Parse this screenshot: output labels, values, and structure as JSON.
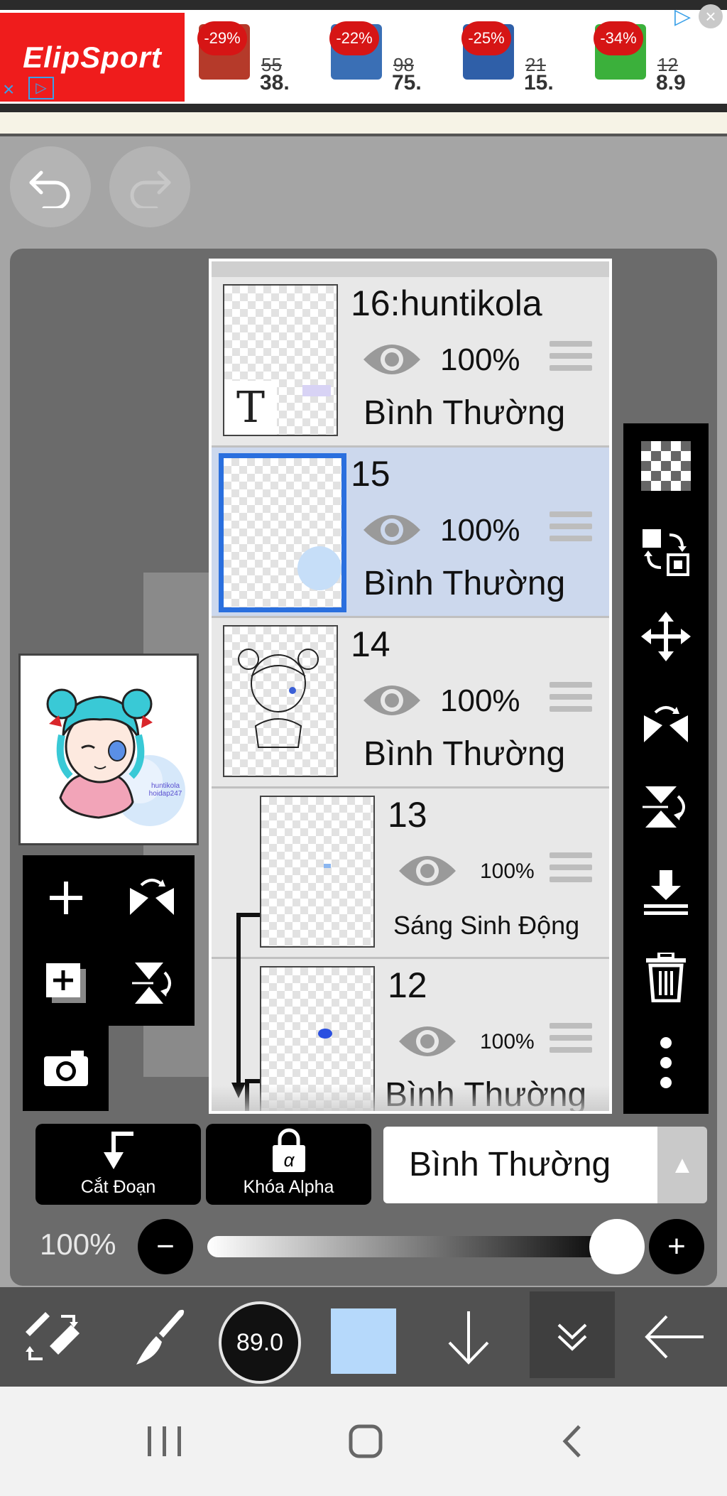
{
  "ad": {
    "brand": "ElipSport",
    "products": [
      {
        "discount": "-29%",
        "old_price": "55",
        "new_price": "38.",
        "color": "#b53a2a"
      },
      {
        "discount": "-22%",
        "old_price": "98",
        "new_price": "75.",
        "color": "#3a6fb5"
      },
      {
        "discount": "-25%",
        "old_price": "21",
        "new_price": "15.",
        "color": "#2f5fa8"
      },
      {
        "discount": "-34%",
        "old_price": "12",
        "new_price": "8.9",
        "color": "#3bb03b"
      }
    ]
  },
  "toolbar_top": {
    "undo_icon": "undo-arrow",
    "redo_icon": "redo-arrow"
  },
  "layers": [
    {
      "name": "16:huntikola",
      "opacity": "100%",
      "blend": "Bình Thường",
      "type": "text",
      "text_marker": "T",
      "selected": false,
      "clipped": false
    },
    {
      "name": "15",
      "opacity": "100%",
      "blend": "Bình Thường",
      "type": "image",
      "selected": true,
      "clipped": false
    },
    {
      "name": "14",
      "opacity": "100%",
      "blend": "Bình Thường",
      "type": "image",
      "selected": false,
      "clipped": false
    },
    {
      "name": "13",
      "opacity": "100%",
      "blend": "Sáng Sinh Động",
      "type": "image",
      "selected": false,
      "clipped": true
    },
    {
      "name": "12",
      "opacity": "100%",
      "blend": "Bình Thường",
      "type": "image",
      "selected": false,
      "clipped": true
    }
  ],
  "preview_text": "huntikola hoidap247",
  "layer_actions": {
    "clip_label": "Cắt Đoạn",
    "alpha_glyph": "α",
    "alpha_lock_label": "Khóa Alpha",
    "blend_mode": "Bình Thường",
    "dropdown_glyph": "▲"
  },
  "opacity": {
    "label": "100%",
    "value": 1.0,
    "minus": "−",
    "plus": "+"
  },
  "bottom_bar": {
    "brush_size": "89.0",
    "color": "#b6d9fb"
  },
  "glyphs": {
    "add": "+",
    "add_small": "+"
  },
  "nav": {
    "recent_icon": "recent-apps-icon",
    "home_icon": "home-icon",
    "back_icon": "back-icon"
  }
}
